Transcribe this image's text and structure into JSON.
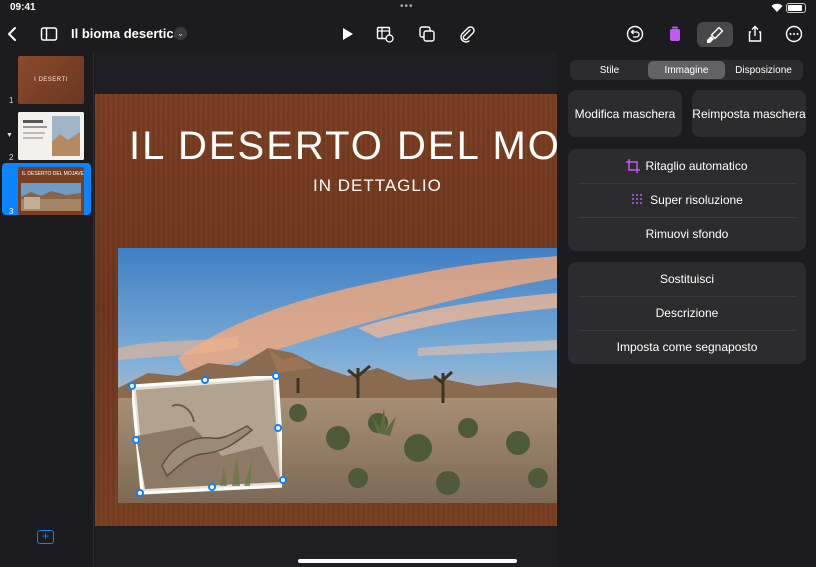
{
  "status": {
    "time": "09:41"
  },
  "toolbar": {
    "doc_title": "Il bioma desertico"
  },
  "navigator": {
    "slides": [
      {
        "number": "1",
        "label": "I DESERTI"
      },
      {
        "number": "2"
      },
      {
        "number": "3",
        "label": "IL DESERTO DEL MOJAVE"
      }
    ]
  },
  "slide": {
    "title": "IL DESERTO DEL MOJ",
    "subtitle": "IN DETTAGLIO"
  },
  "inspector": {
    "tabs": [
      "Stile",
      "Immagine",
      "Disposizione"
    ],
    "active_tab": "Immagine",
    "edit_mask": "Modifica maschera",
    "reset_mask": "Reimposta maschera",
    "group1": [
      "Ritaglio automatico",
      "Super risoluzione",
      "Rimuovi sfondo"
    ],
    "group2": [
      "Sostituisci",
      "Descrizione",
      "Imposta come segnaposto"
    ]
  },
  "colors": {
    "accent": "#0a84ff",
    "slide_bg": "#7b3e22",
    "inspector_bg": "#1c1c1e",
    "card_bg": "#2c2c2e",
    "tab_active": "#636366"
  },
  "icons": [
    "back-icon",
    "sidebar-icon",
    "chevron-down-icon",
    "play-icon",
    "table-chart-icon",
    "shapes-icon",
    "paperclip-icon",
    "undo-icon",
    "trash-icon",
    "paintbrush-icon",
    "share-icon",
    "more-icon",
    "crop-icon",
    "dots-grid-icon",
    "add-slide-icon"
  ]
}
